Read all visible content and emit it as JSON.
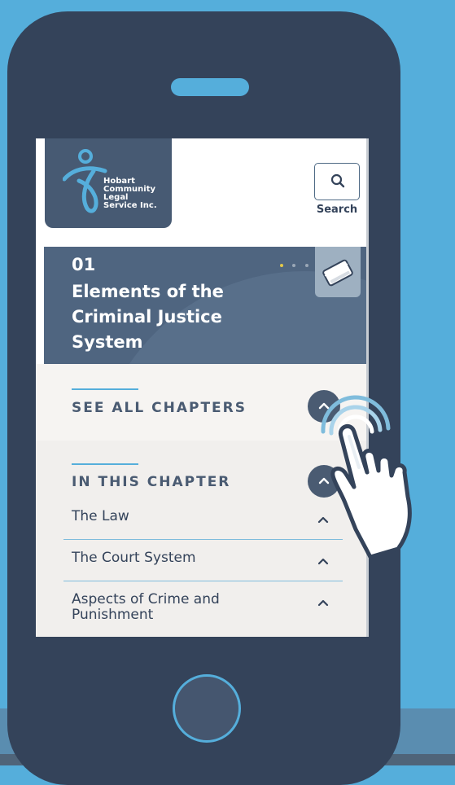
{
  "brand": {
    "line1": "Hobart",
    "line2": "Community",
    "line3": "Legal",
    "line4": "Service Inc."
  },
  "header": {
    "search_label": "Search"
  },
  "chapter": {
    "number": "01",
    "title": "Elements of the Criminal Justice System",
    "pager_active_index": 0,
    "pager_count": 3
  },
  "see_all": {
    "label": "SEE ALL CHAPTERS"
  },
  "in_chapter": {
    "label": "IN THIS CHAPTER",
    "items": [
      {
        "label": "The Law"
      },
      {
        "label": "The Court System"
      },
      {
        "label": "Aspects of Crime and Punishment"
      }
    ]
  },
  "colors": {
    "background": "#55aedb",
    "phone_body": "#34435a",
    "banner": "#4f6580",
    "accent": "#55aedb",
    "pager_active": "#e2c84a"
  },
  "icons": {
    "logo": "person-swirl-icon",
    "search": "search-icon",
    "book": "book-icon",
    "toggle": "chevron-up-icon",
    "pointer": "hand-pointer-icon"
  }
}
